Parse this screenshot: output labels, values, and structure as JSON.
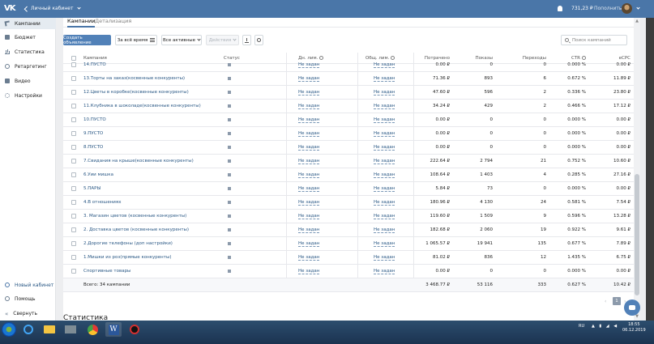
{
  "topbar": {
    "logo": "VK",
    "cabinet_label": "Личный кабинет",
    "balance": "731,23 ₽",
    "topup": "Пополнить"
  },
  "sidebar": {
    "items": [
      {
        "label": "Кампании",
        "icon": "campaigns-icon",
        "active": true
      },
      {
        "label": "Бюджет",
        "icon": "budget-icon"
      },
      {
        "label": "Статистика",
        "icon": "statistics-icon"
      },
      {
        "label": "Ретаргетинг",
        "icon": "retargeting-icon"
      },
      {
        "label": "Видео",
        "icon": "video-icon"
      },
      {
        "label": "Настройки",
        "icon": "settings-icon"
      }
    ],
    "bottom": [
      {
        "label": "Новый кабинет",
        "icon": "new-cabinet-icon"
      },
      {
        "label": "Помощь",
        "icon": "help-icon"
      },
      {
        "label": "Свернуть",
        "icon": "collapse-icon"
      }
    ]
  },
  "tabs": {
    "campaigns": "Кампании",
    "details": "Детализация"
  },
  "toolbar": {
    "create": "Создать объявление",
    "period": "За всё время",
    "filter": "Все активные",
    "actions": "Действия",
    "search_placeholder": "Поиск кампаний"
  },
  "table": {
    "headers": {
      "campaign": "Кампания",
      "status": "Статус",
      "day_limit": "Дн. лим.",
      "total_limit": "Общ. лим.",
      "spent": "Потрачено",
      "views": "Показы",
      "clicks": "Переходы",
      "ctr": "CTR",
      "ecpc": "eCPC"
    },
    "rows": [
      {
        "name": "14.ПУСТО",
        "day": "Не задан",
        "total": "Не задан",
        "spent": "0.00 ₽",
        "views": "0",
        "clicks": "0",
        "ctr": "0.000 %",
        "ecpc": "0.00 ₽"
      },
      {
        "name": "13.Торты на заказ(косвенные конкуренты)",
        "day": "Не задан",
        "total": "Не задан",
        "spent": "71.36 ₽",
        "views": "893",
        "clicks": "6",
        "ctr": "0.672 %",
        "ecpc": "11.89 ₽"
      },
      {
        "name": "12.Цветы в коробке(косвенные конкуренты)",
        "day": "Не задан",
        "total": "Не задан",
        "spent": "47.60 ₽",
        "views": "596",
        "clicks": "2",
        "ctr": "0.336 %",
        "ecpc": "23.80 ₽"
      },
      {
        "name": "11.Клубника в шоколаде(косвенные конкуренты)",
        "day": "Не задан",
        "total": "Не задан",
        "spent": "34.24 ₽",
        "views": "429",
        "clicks": "2",
        "ctr": "0.466 %",
        "ecpc": "17.12 ₽"
      },
      {
        "name": "10.ПУСТО",
        "day": "Не задан",
        "total": "Не задан",
        "spent": "0.00 ₽",
        "views": "0",
        "clicks": "0",
        "ctr": "0.000 %",
        "ecpc": "0.00 ₽"
      },
      {
        "name": "9.ПУСТО",
        "day": "Не задан",
        "total": "Не задан",
        "spent": "0.00 ₽",
        "views": "0",
        "clicks": "0",
        "ctr": "0.000 %",
        "ecpc": "0.00 ₽"
      },
      {
        "name": "8.ПУСТО",
        "day": "Не задан",
        "total": "Не задан",
        "spent": "0.00 ₽",
        "views": "0",
        "clicks": "0",
        "ctr": "0.000 %",
        "ecpc": "0.00 ₽"
      },
      {
        "name": "7.Свидания на крыше(косвенные конкуренты)",
        "day": "Не задан",
        "total": "Не задан",
        "spent": "222.64 ₽",
        "views": "2 794",
        "clicks": "21",
        "ctr": "0.752 %",
        "ecpc": "10.60 ₽"
      },
      {
        "name": "6.Уии мишка",
        "day": "Не задан",
        "total": "Не задан",
        "spent": "108.64 ₽",
        "views": "1 403",
        "clicks": "4",
        "ctr": "0.285 %",
        "ecpc": "27.16 ₽"
      },
      {
        "name": "5.ПАРЫ",
        "day": "Не задан",
        "total": "Не задан",
        "spent": "5.84 ₽",
        "views": "73",
        "clicks": "0",
        "ctr": "0.000 %",
        "ecpc": "0.00 ₽"
      },
      {
        "name": "4.В отношениях",
        "day": "Не задан",
        "total": "Не задан",
        "spent": "180.96 ₽",
        "views": "4 130",
        "clicks": "24",
        "ctr": "0.581 %",
        "ecpc": "7.54 ₽"
      },
      {
        "name": "3. Магазин цветов (косвенные конкуренты)",
        "day": "Не задан",
        "total": "Не задан",
        "spent": "119.60 ₽",
        "views": "1 509",
        "clicks": "9",
        "ctr": "0.596 %",
        "ecpc": "13.28 ₽"
      },
      {
        "name": "2. Доставка цветов (косвенные конкуренты)",
        "day": "Не задан",
        "total": "Не задан",
        "spent": "182.68 ₽",
        "views": "2 060",
        "clicks": "19",
        "ctr": "0.922 %",
        "ecpc": "9.61 ₽"
      },
      {
        "name": "2.Дорогие телефоны (доп настройки)",
        "day": "Не задан",
        "total": "Не задан",
        "spent": "1 065.57 ₽",
        "views": "19 941",
        "clicks": "135",
        "ctr": "0.677 %",
        "ecpc": "7.89 ₽"
      },
      {
        "name": "1.Мишки из роз(прямые конкуренты)",
        "day": "Не задан",
        "total": "Не задан",
        "spent": "81.02 ₽",
        "views": "836",
        "clicks": "12",
        "ctr": "1.435 %",
        "ecpc": "6.75 ₽"
      },
      {
        "name": "Спортивные товары",
        "day": "Не задан",
        "total": "Не задан",
        "spent": "0.00 ₽",
        "views": "0",
        "clicks": "0",
        "ctr": "0.000 %",
        "ecpc": "0.00 ₽"
      }
    ],
    "total": {
      "name": "Всего: 34 кампании",
      "spent": "3 468.77 ₽",
      "views": "53 116",
      "clicks": "333",
      "ctr": "0.627 %",
      "ecpc": "10.42 ₽"
    }
  },
  "pager": {
    "current": "1"
  },
  "stats_heading": "Статистика",
  "taskbar": {
    "lang": "RU",
    "time": "18:55",
    "date": "06.12.2019"
  }
}
